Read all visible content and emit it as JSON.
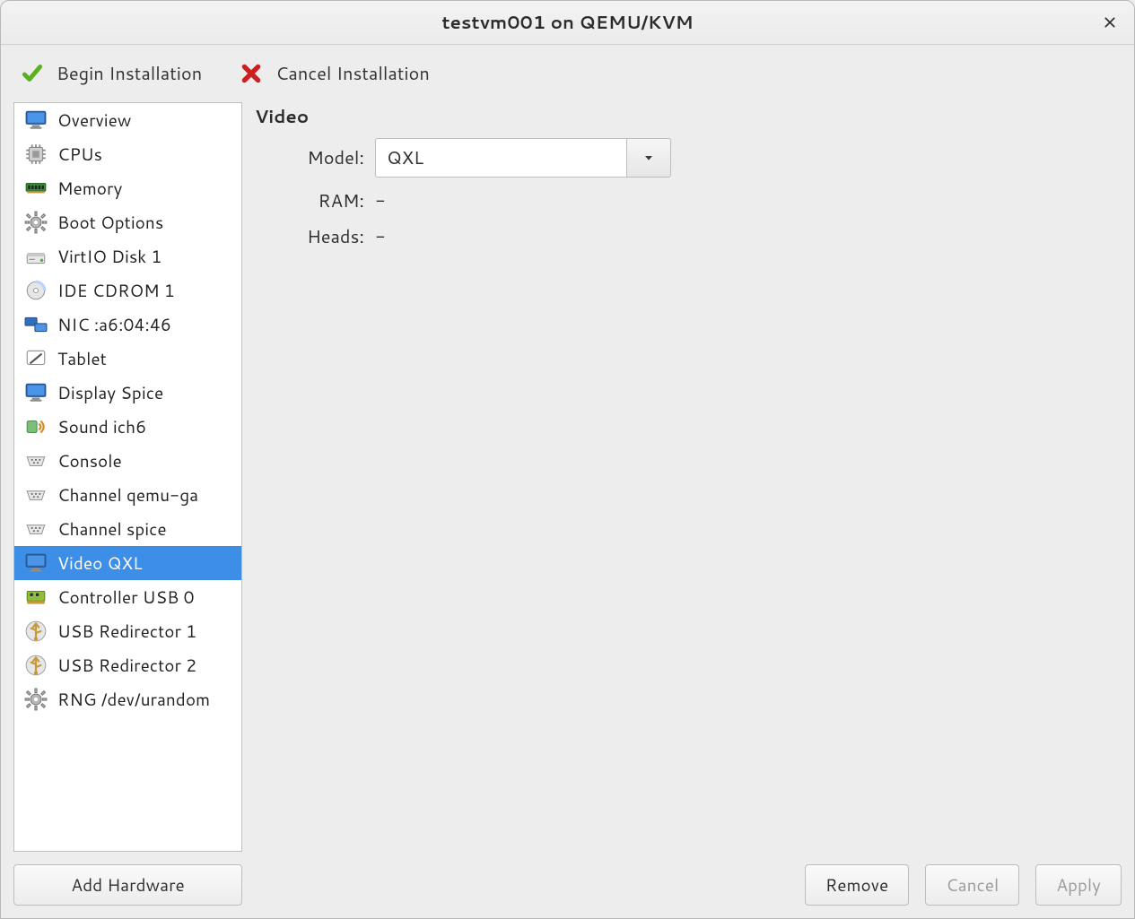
{
  "window": {
    "title": "testvm001 on QEMU/KVM"
  },
  "toolbar": {
    "begin_label": "Begin Installation",
    "cancel_label": "Cancel Installation"
  },
  "sidebar": {
    "items": [
      {
        "id": "overview",
        "label": "Overview",
        "icon": "monitor-icon",
        "selected": false
      },
      {
        "id": "cpus",
        "label": "CPUs",
        "icon": "cpu-icon",
        "selected": false
      },
      {
        "id": "memory",
        "label": "Memory",
        "icon": "memory-icon",
        "selected": false
      },
      {
        "id": "boot-options",
        "label": "Boot Options",
        "icon": "gear-icon",
        "selected": false
      },
      {
        "id": "virtio-disk-1",
        "label": "VirtIO Disk 1",
        "icon": "disk-icon",
        "selected": false
      },
      {
        "id": "ide-cdrom-1",
        "label": "IDE CDROM 1",
        "icon": "cdrom-icon",
        "selected": false
      },
      {
        "id": "nic-a60446",
        "label": "NIC :a6:04:46",
        "icon": "nic-icon",
        "selected": false
      },
      {
        "id": "tablet",
        "label": "Tablet",
        "icon": "tablet-icon",
        "selected": false
      },
      {
        "id": "display-spice",
        "label": "Display Spice",
        "icon": "monitor-icon",
        "selected": false
      },
      {
        "id": "sound-ich6",
        "label": "Sound ich6",
        "icon": "sound-icon",
        "selected": false
      },
      {
        "id": "console",
        "label": "Console",
        "icon": "serial-icon",
        "selected": false
      },
      {
        "id": "channel-qemu-ga",
        "label": "Channel qemu-ga",
        "icon": "serial-icon",
        "selected": false
      },
      {
        "id": "channel-spice",
        "label": "Channel spice",
        "icon": "serial-icon",
        "selected": false
      },
      {
        "id": "video-qxl",
        "label": "Video QXL",
        "icon": "monitor-icon",
        "selected": true
      },
      {
        "id": "controller-usb-0",
        "label": "Controller USB 0",
        "icon": "controller-icon",
        "selected": false
      },
      {
        "id": "usb-redirector-1",
        "label": "USB Redirector 1",
        "icon": "usb-icon",
        "selected": false
      },
      {
        "id": "usb-redirector-2",
        "label": "USB Redirector 2",
        "icon": "usb-icon",
        "selected": false
      },
      {
        "id": "rng-dev-urandom",
        "label": "RNG /dev/urandom",
        "icon": "gear-icon",
        "selected": false
      }
    ],
    "add_hardware_label": "Add Hardware"
  },
  "details": {
    "section_title": "Video",
    "model_label": "Model:",
    "model_value": "QXL",
    "ram_label": "RAM:",
    "ram_value": "-",
    "heads_label": "Heads:",
    "heads_value": "-"
  },
  "footer": {
    "remove_label": "Remove",
    "cancel_label": "Cancel",
    "apply_label": "Apply",
    "cancel_enabled": false,
    "apply_enabled": false
  }
}
